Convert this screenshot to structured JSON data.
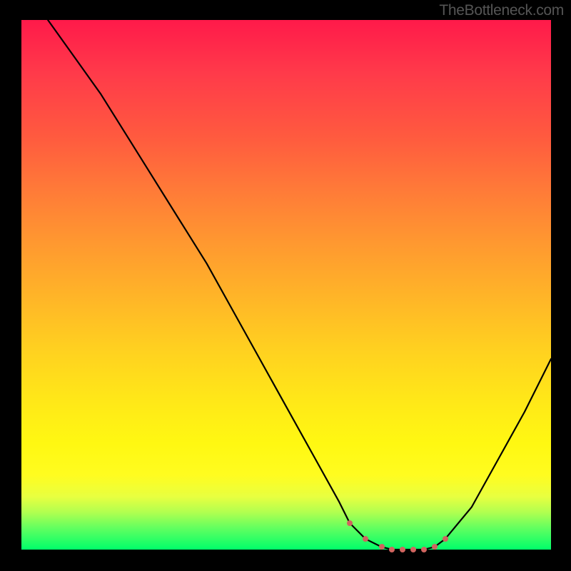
{
  "attribution": "TheBottleneck.com",
  "chart_data": {
    "type": "line",
    "title": "",
    "xlabel": "",
    "ylabel": "",
    "xlim": [
      0,
      100
    ],
    "ylim": [
      0,
      100
    ],
    "curve": {
      "x": [
        5,
        10,
        15,
        20,
        25,
        30,
        35,
        40,
        45,
        50,
        55,
        60,
        62,
        65,
        68,
        70,
        72,
        74,
        76,
        78,
        80,
        85,
        90,
        95,
        100
      ],
      "y": [
        100,
        93,
        86,
        78,
        70,
        62,
        54,
        45,
        36,
        27,
        18,
        9,
        5,
        2,
        0.5,
        0,
        0,
        0,
        0,
        0.5,
        2,
        8,
        17,
        26,
        36
      ]
    },
    "markers": {
      "x": [
        62,
        65,
        68,
        70,
        72,
        74,
        76,
        78,
        80
      ],
      "y": [
        5,
        2,
        0.5,
        0,
        0,
        0,
        0,
        0.5,
        2
      ],
      "color": "#d0645f"
    },
    "background_gradient": {
      "type": "vertical",
      "stops": [
        {
          "pos": 0.0,
          "color": "#ff1a4a"
        },
        {
          "pos": 0.5,
          "color": "#ffb028"
        },
        {
          "pos": 0.85,
          "color": "#fffc20"
        },
        {
          "pos": 1.0,
          "color": "#00ff6a"
        }
      ]
    }
  }
}
